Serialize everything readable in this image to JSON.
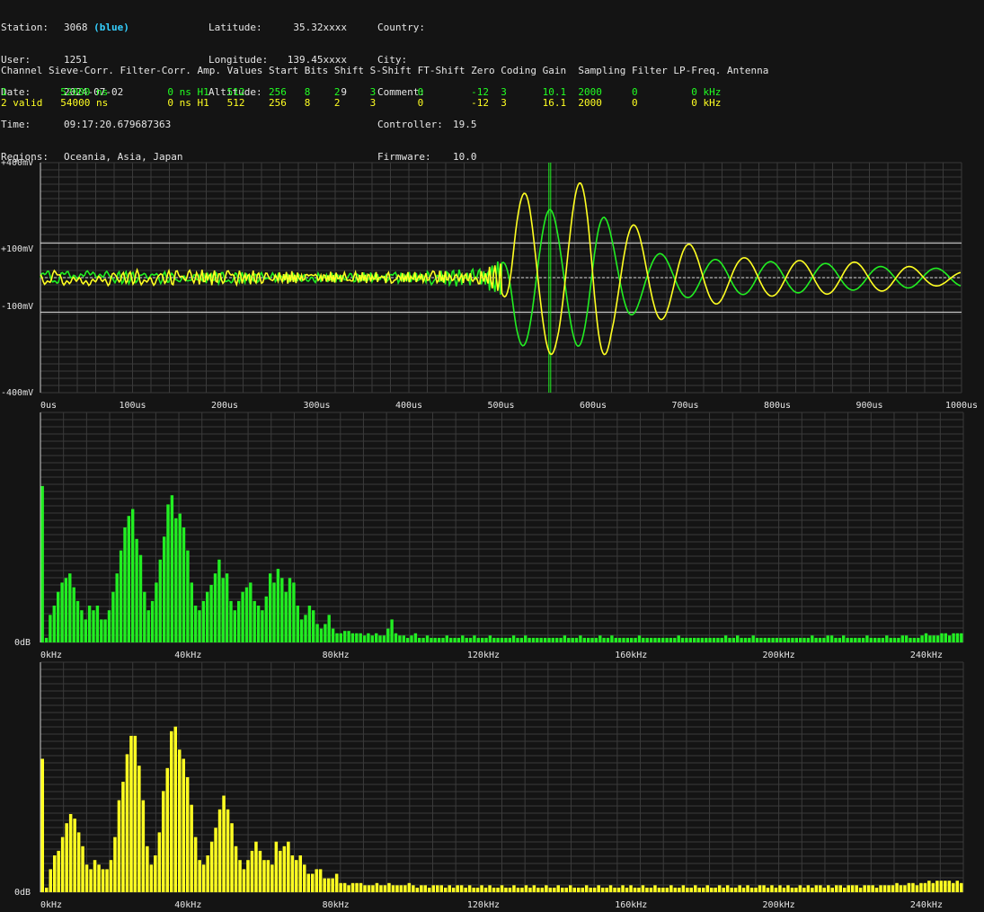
{
  "header": {
    "station_label": "Station:",
    "station_value": "3068",
    "station_color": "(blue)",
    "user_label": "User:",
    "user_value": "1251",
    "date_label": "Date:",
    "date_value": "2024-07-02",
    "time_label": "Time:",
    "time_value": "09:17:20.679687363",
    "regions_label": "Regions:",
    "regions_value": "Oceania, Asia, Japan",
    "latitude_label": "Latitude:",
    "latitude_value": "35.32xxxx",
    "longitude_label": "Longitude:",
    "longitude_value": "139.45xxxx",
    "altitude_label": "Altitude:",
    "altitude_value": "9",
    "country_label": "Country:",
    "city_label": "City:",
    "comment_label": "Comment:",
    "controller_label": "Controller:",
    "controller_value": "19.5",
    "firmware_label": "Firmware:",
    "firmware_value": "10.0"
  },
  "channel_table": {
    "headers": "Channel Sieve-Corr. Filter-Corr. Amp. Values Start Bits Shift S-Shift FT-Shift Zero Coding Gain  Sampling Filter LP-Freq. Antenna",
    "rows": [
      "1         52000 ns          0 ns H1   512    256   8    2     3       0        -12  3      10.1  2000     0         0 kHz",
      "2 valid   54000 ns          0 ns H1   512    256   8    2     3       0        -12  3      16.1  2000     0         0 kHz"
    ]
  },
  "colors": {
    "background": "#141414",
    "grid": "#3a3a3a",
    "channel1": "#22ee22",
    "channel2": "#ffff22",
    "trigger": "#22ee22"
  },
  "chart_data": [
    {
      "type": "line",
      "xlim": [
        0,
        1000
      ],
      "ylim": [
        -400,
        400
      ],
      "x_tick_labels": [
        "0us",
        "100us",
        "200us",
        "300us",
        "400us",
        "500us",
        "600us",
        "700us",
        "800us",
        "900us",
        "1000us"
      ],
      "y_tick_labels": [
        "+400mV",
        "+100mV",
        "-100mV",
        "-400mV"
      ],
      "y_ticks": [
        400,
        100,
        -100,
        -400
      ],
      "reference_lines_mV": [
        120,
        -120,
        0
      ],
      "trigger_us": 552,
      "series": [
        {
          "name": "1",
          "color": "#22ee22",
          "envelope": [
            [
              0,
              20
            ],
            [
              100,
              15
            ],
            [
              200,
              15
            ],
            [
              300,
              12
            ],
            [
              400,
              15
            ],
            [
              470,
              25
            ],
            [
              500,
              60
            ],
            [
              515,
              230
            ],
            [
              540,
              250
            ],
            [
              570,
              220
            ],
            [
              600,
              260
            ],
            [
              620,
              180
            ],
            [
              660,
              90
            ],
            [
              700,
              70
            ],
            [
              750,
              60
            ],
            [
              800,
              55
            ],
            [
              850,
              50
            ],
            [
              900,
              40
            ],
            [
              1000,
              30
            ]
          ]
        },
        {
          "name": "2",
          "color": "#ffff22",
          "envelope": [
            [
              0,
              20
            ],
            [
              100,
              20
            ],
            [
              200,
              20
            ],
            [
              300,
              15
            ],
            [
              400,
              15
            ],
            [
              470,
              20
            ],
            [
              500,
              50
            ],
            [
              515,
              280
            ],
            [
              530,
              300
            ],
            [
              560,
              260
            ],
            [
              600,
              370
            ],
            [
              620,
              220
            ],
            [
              660,
              160
            ],
            [
              700,
              120
            ],
            [
              760,
              70
            ],
            [
              820,
              60
            ],
            [
              880,
              55
            ],
            [
              940,
              40
            ],
            [
              1000,
              20
            ]
          ]
        }
      ]
    },
    {
      "type": "bar",
      "ylabel": "0dB",
      "x_tick_labels": [
        "0kHz",
        "40kHz",
        "80kHz",
        "120kHz",
        "160kHz",
        "200kHz",
        "240kHz"
      ],
      "xlim": [
        0,
        250
      ],
      "color": "#22ee22",
      "values": [
        68,
        2,
        12,
        16,
        22,
        26,
        28,
        30,
        24,
        18,
        14,
        10,
        16,
        14,
        16,
        10,
        10,
        14,
        22,
        30,
        40,
        50,
        55,
        58,
        45,
        38,
        22,
        14,
        18,
        26,
        36,
        46,
        60,
        64,
        54,
        56,
        50,
        40,
        26,
        16,
        14,
        18,
        22,
        25,
        30,
        36,
        28,
        30,
        18,
        14,
        18,
        22,
        24,
        26,
        18,
        16,
        14,
        20,
        30,
        26,
        32,
        28,
        22,
        28,
        26,
        16,
        10,
        12,
        16,
        14,
        8,
        6,
        8,
        12,
        6,
        4,
        4,
        5,
        5,
        4,
        4,
        4,
        3,
        4,
        3,
        4,
        3,
        3,
        6,
        10,
        4,
        3,
        3,
        2,
        3,
        4,
        2,
        2,
        3,
        2,
        2,
        2,
        2,
        3,
        2,
        2,
        2,
        3,
        2,
        2,
        3,
        2,
        2,
        2,
        3,
        2,
        2,
        2,
        2,
        2,
        3,
        2,
        2,
        3,
        2,
        2,
        2,
        2,
        2,
        2,
        2,
        2,
        2,
        3,
        2,
        2,
        2,
        3,
        2,
        2,
        2,
        2,
        3,
        2,
        2,
        3,
        2,
        2,
        2,
        2,
        2,
        2,
        3,
        2,
        2,
        2,
        2,
        2,
        2,
        2,
        2,
        2,
        3,
        2,
        2,
        2,
        2,
        2,
        2,
        2,
        2,
        2,
        2,
        2,
        3,
        2,
        2,
        3,
        2,
        2,
        2,
        3,
        2,
        2,
        2,
        2,
        2,
        2,
        2,
        2,
        2,
        2,
        2,
        2,
        2,
        2,
        3,
        2,
        2,
        2,
        3,
        3,
        2,
        2,
        3,
        2,
        2,
        2,
        2,
        2,
        3,
        2,
        2,
        2,
        2,
        3,
        2,
        2,
        2,
        3,
        3,
        2,
        2,
        2,
        3,
        4,
        3,
        3,
        3,
        4,
        4,
        3,
        4,
        4,
        4
      ]
    },
    {
      "type": "bar",
      "ylabel": "0dB",
      "x_tick_labels": [
        "0kHz",
        "40kHz",
        "80kHz",
        "120kHz",
        "160kHz",
        "200kHz",
        "240kHz"
      ],
      "xlim": [
        0,
        250
      ],
      "color": "#ffff22",
      "values": [
        58,
        2,
        10,
        16,
        18,
        24,
        30,
        34,
        32,
        26,
        20,
        12,
        10,
        14,
        12,
        10,
        10,
        14,
        24,
        40,
        48,
        60,
        68,
        68,
        55,
        40,
        20,
        12,
        16,
        26,
        44,
        54,
        70,
        72,
        62,
        58,
        50,
        38,
        24,
        14,
        12,
        16,
        22,
        28,
        36,
        42,
        36,
        30,
        20,
        14,
        10,
        14,
        18,
        22,
        18,
        14,
        14,
        12,
        22,
        18,
        20,
        22,
        16,
        14,
        16,
        12,
        8,
        8,
        10,
        10,
        6,
        6,
        6,
        8,
        4,
        4,
        3,
        4,
        4,
        4,
        3,
        3,
        3,
        4,
        3,
        3,
        4,
        3,
        3,
        3,
        3,
        4,
        3,
        2,
        3,
        3,
        2,
        3,
        3,
        3,
        2,
        3,
        2,
        3,
        3,
        2,
        3,
        2,
        2,
        3,
        2,
        3,
        2,
        2,
        3,
        2,
        2,
        3,
        2,
        2,
        3,
        2,
        3,
        2,
        2,
        3,
        2,
        2,
        3,
        2,
        2,
        3,
        2,
        2,
        2,
        3,
        2,
        2,
        3,
        2,
        2,
        3,
        2,
        2,
        3,
        2,
        3,
        2,
        2,
        3,
        2,
        2,
        3,
        2,
        2,
        2,
        3,
        2,
        2,
        3,
        2,
        2,
        3,
        2,
        2,
        3,
        2,
        2,
        3,
        2,
        3,
        2,
        2,
        3,
        2,
        3,
        2,
        2,
        3,
        3,
        2,
        3,
        2,
        3,
        2,
        3,
        2,
        2,
        3,
        2,
        3,
        2,
        3,
        3,
        2,
        3,
        2,
        3,
        3,
        2,
        3,
        3,
        3,
        2,
        3,
        3,
        3,
        2,
        3,
        3,
        3,
        3,
        4,
        3,
        3,
        4,
        4,
        3,
        4,
        4,
        5,
        4,
        5,
        5,
        5,
        5,
        4,
        5,
        4
      ]
    }
  ]
}
